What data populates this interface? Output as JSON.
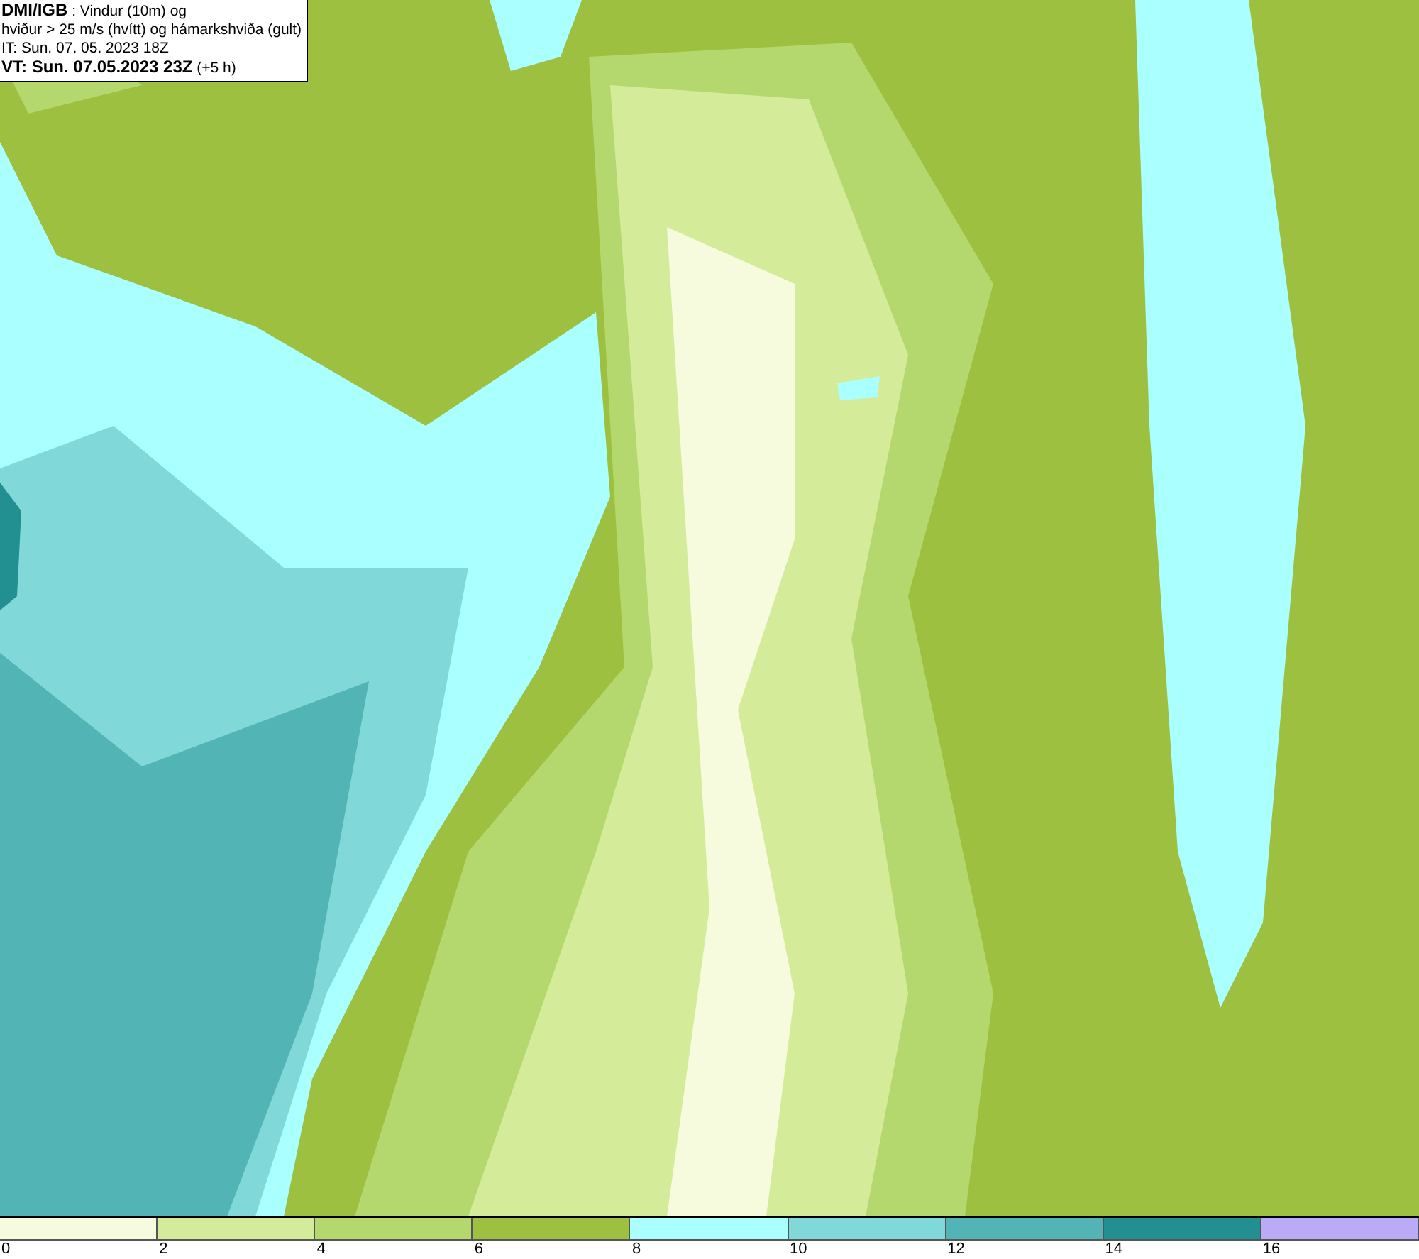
{
  "title_box": {
    "lines": [
      "**DMI/IGB** : Vindur (10m) og",
      "hviður > 25 m/s (hvítt) og hámarkshviða (gult)",
      "IT: Sun. 07. 05. 2023 18Z",
      "**VT: Sun. 07.05.2023 23Z** (+5 h)"
    ]
  },
  "legend": {
    "bins": [
      {
        "label": "0",
        "color": "#f5fbdc"
      },
      {
        "label": "2",
        "color": "#d4ec9a"
      },
      {
        "label": "4",
        "color": "#b5d86e"
      },
      {
        "label": "6",
        "color": "#9dc040"
      },
      {
        "label": "8",
        "color": "#aaffff"
      },
      {
        "label": "10",
        "color": "#80d8d8"
      },
      {
        "label": "12",
        "color": "#52b4b4"
      },
      {
        "label": "14",
        "color": "#229090"
      },
      {
        "label": "16",
        "color": "#bbaaf5"
      }
    ]
  }
}
